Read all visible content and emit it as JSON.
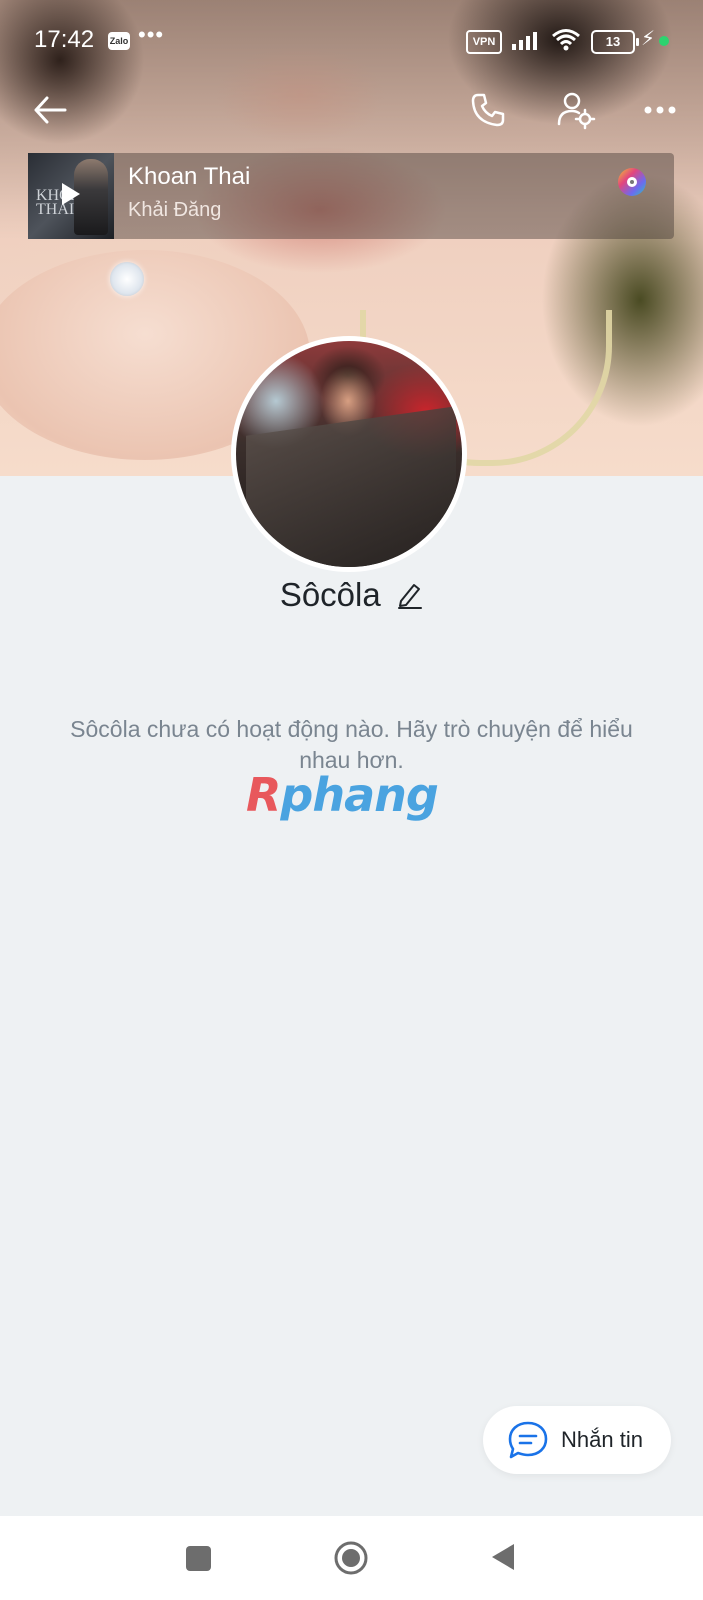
{
  "status_bar": {
    "time": "17:42",
    "app_badge": "Zalo",
    "more_dots": "•••",
    "vpn": "VPN",
    "battery": "13"
  },
  "header": {
    "back_icon": "arrow-left-icon",
    "call_icon": "phone-icon",
    "settings_icon": "user-settings-icon",
    "more_icon": "more-horizontal-icon"
  },
  "music": {
    "title": "Khoan Thai",
    "artist": "Khải Đăng",
    "cover_text": "KHOAN THAI"
  },
  "profile": {
    "name": "Sôcôla",
    "empty_message": "Sôcôla chưa có hoạt động nào. Hãy trò chuyện để hiểu nhau hơn."
  },
  "watermark": {
    "first": "R",
    "rest": "phang"
  },
  "actions": {
    "message_label": "Nhắn tin"
  },
  "colors": {
    "background": "#eef1f3",
    "accent": "#1a73e8",
    "text_primary": "#1f2429",
    "text_secondary": "#7a8590"
  }
}
